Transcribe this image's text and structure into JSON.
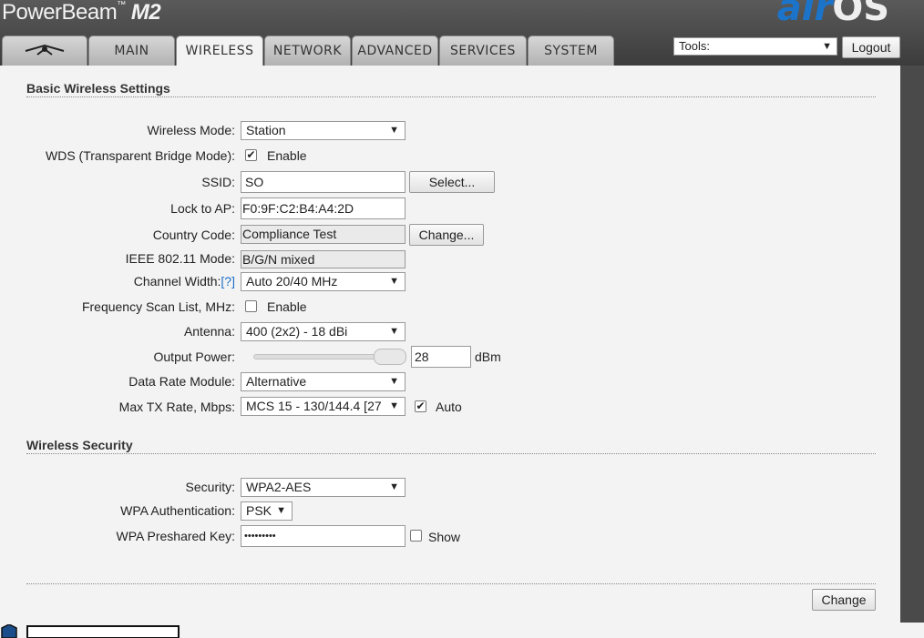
{
  "header": {
    "brand": "PowerBeam",
    "brand_tm": "™",
    "model": "M2",
    "logo_air": "air",
    "logo_os": "OS"
  },
  "tabs": [
    {
      "label": "",
      "icon": "ubiquiti-logo-icon"
    },
    {
      "label": "MAIN"
    },
    {
      "label": "WIRELESS",
      "active": true
    },
    {
      "label": "NETWORK"
    },
    {
      "label": "ADVANCED"
    },
    {
      "label": "SERVICES"
    },
    {
      "label": "SYSTEM"
    }
  ],
  "tools": {
    "value": "Tools:",
    "arrow": "▼"
  },
  "logout_label": "Logout",
  "basic": {
    "title": "Basic Wireless Settings",
    "wireless_mode": {
      "label": "Wireless Mode:",
      "value": "Station"
    },
    "wds": {
      "label": "WDS (Transparent Bridge Mode):",
      "checked": true,
      "text": "Enable"
    },
    "ssid": {
      "label": "SSID:",
      "value": "SO",
      "button": "Select..."
    },
    "lock_ap": {
      "label": "Lock to AP:",
      "value": "F0:9F:C2:B4:A4:2D"
    },
    "country": {
      "label": "Country Code:",
      "value": "Compliance Test",
      "button": "Change..."
    },
    "ieee": {
      "label": "IEEE 802.11 Mode:",
      "value": "B/G/N mixed"
    },
    "channel_width": {
      "label": "Channel Width:",
      "help": "[?]",
      "value": "Auto 20/40 MHz"
    },
    "freq_scan": {
      "label": "Frequency Scan List, MHz:",
      "checked": false,
      "text": "Enable"
    },
    "antenna": {
      "label": "Antenna:",
      "value": "400 (2x2) - 18 dBi"
    },
    "output_power": {
      "label": "Output Power:",
      "value": "28",
      "unit": "dBm",
      "level": 0.85
    },
    "data_rate": {
      "label": "Data Rate Module:",
      "value": "Alternative"
    },
    "max_tx": {
      "label": "Max TX Rate, Mbps:",
      "value": "MCS 15 - 130/144.4 [27",
      "auto_checked": true,
      "auto_text": "Auto"
    }
  },
  "security": {
    "title": "Wireless Security",
    "security": {
      "label": "Security:",
      "value": "WPA2-AES"
    },
    "wpa_auth": {
      "label": "WPA Authentication:",
      "value": "PSK"
    },
    "wpa_key": {
      "label": "WPA Preshared Key:",
      "value": "•••••••••",
      "show_checked": false,
      "show_text": "Show"
    }
  },
  "change_label": "Change",
  "arrow": "▼",
  "check": "✔"
}
